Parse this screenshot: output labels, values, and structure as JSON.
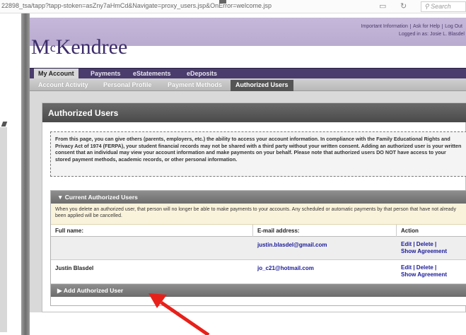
{
  "browser": {
    "url": "22898_tsa/tapp?tapp-stoken=asZny7aHmCd&Navigate=proxy_users.jsp&OnError=welcome.jsp",
    "search_placeholder": "Search",
    "reader_icon": "reader-view-icon",
    "reload_icon": "reload-icon",
    "search_icon": "search-icon"
  },
  "header": {
    "links": [
      "Important Information",
      "Ask for Help",
      "Log Out"
    ],
    "logged_in": "Logged in as: Josie L. Blasdel",
    "logo_part1": "M",
    "logo_sup": "c",
    "logo_part2": "Kendree",
    "brand_color": "#3d2d6b"
  },
  "nav": {
    "primary": [
      "My Account",
      "Payments",
      "eStatements",
      "eDeposits"
    ],
    "secondary": [
      "Account Activity",
      "Personal Profile",
      "Payment Methods",
      "Authorized Users"
    ]
  },
  "page": {
    "title": "Authorized Users",
    "info": "From this page, you can give others (parents, employers, etc.) the ability to access your account information. In compliance with the Family Educational Rights and Privacy Act of 1974 (FERPA), your student financial records may not be shared with a third party without your written consent. Adding an authorized user is your written consent that an individual may view your account information and make payments on your behalf. Please note that authorized users DO NOT have access to your stored payment methods, academic records, or other personal information.",
    "current_section": "Current Authorized Users",
    "notice": "When you delete an authorized user, that person will no longer be able to make payments to your accounts. Any scheduled or automatic payments by that person that have not already been applied will be cancelled.",
    "columns": [
      "Full name:",
      "E-mail address:",
      "Action"
    ],
    "rows": [
      {
        "name": "",
        "email": "justin.blasdel@gmail.com",
        "edit": "Edit",
        "delete": "Delete",
        "agreement": "Show Agreement"
      },
      {
        "name": "Justin Blasdel",
        "email": "jo_c21@hotmail.com",
        "edit": "Edit",
        "delete": "Delete",
        "agreement": "Show Agreement"
      }
    ],
    "add_section": "Add Authorized User",
    "collapse_icon": "triangle-down-icon",
    "expand_icon": "triangle-right-icon",
    "annotation": "red-arrow",
    "annotation_color": "#e8201a"
  }
}
